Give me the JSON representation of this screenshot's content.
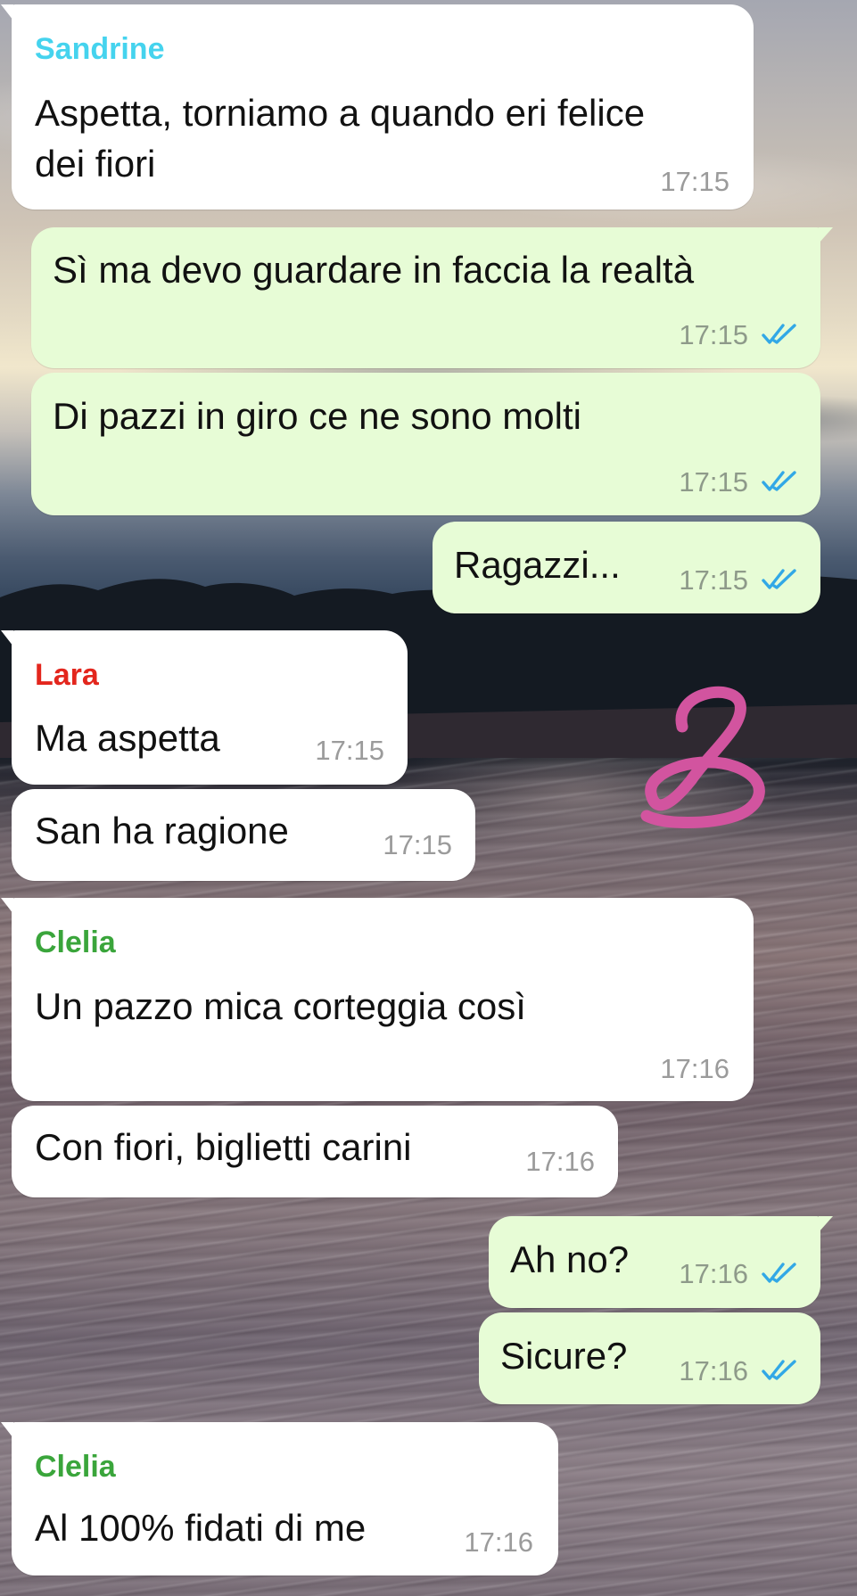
{
  "colors": {
    "incoming_bubble": "#ffffff",
    "outgoing_bubble": "#e7fcd6",
    "timestamp": "#9b9b9b",
    "read_ticks": "#32a8e6",
    "sender_sandrine": "#45d3ee",
    "sender_lara": "#e3261d",
    "sender_clelia": "#3aa53b",
    "doodle": "#d2549f"
  },
  "icons": {
    "read_receipt": "double-check-icon",
    "doodle": "pink-scribble-doodle"
  },
  "messages": [
    {
      "direction": "incoming",
      "sender": "Sandrine",
      "lines": [
        "Aspetta, torniamo a quando eri felice",
        "dei fiori"
      ],
      "time": "17:15"
    },
    {
      "direction": "outgoing",
      "lines": [
        "Sì ma devo guardare in faccia la realtà"
      ],
      "time": "17:15",
      "status": "read"
    },
    {
      "direction": "outgoing",
      "lines": [
        "Di pazzi in giro ce ne sono molti"
      ],
      "time": "17:15",
      "status": "read"
    },
    {
      "direction": "outgoing",
      "lines": [
        "Ragazzi..."
      ],
      "time": "17:15",
      "status": "read"
    },
    {
      "direction": "incoming",
      "sender": "Lara",
      "lines": [
        "Ma aspetta"
      ],
      "time": "17:15"
    },
    {
      "direction": "incoming",
      "lines": [
        "San ha ragione"
      ],
      "time": "17:15"
    },
    {
      "direction": "incoming",
      "sender": "Clelia",
      "lines": [
        "Un pazzo mica corteggia così"
      ],
      "time": "17:16"
    },
    {
      "direction": "incoming",
      "lines": [
        "Con fiori, biglietti carini"
      ],
      "time": "17:16"
    },
    {
      "direction": "outgoing",
      "lines": [
        "Ah no?"
      ],
      "time": "17:16",
      "status": "read"
    },
    {
      "direction": "outgoing",
      "lines": [
        "Sicure?"
      ],
      "time": "17:16",
      "status": "read"
    },
    {
      "direction": "incoming",
      "sender": "Clelia",
      "lines": [
        "Al 100% fidati di me"
      ],
      "time": "17:16"
    }
  ]
}
